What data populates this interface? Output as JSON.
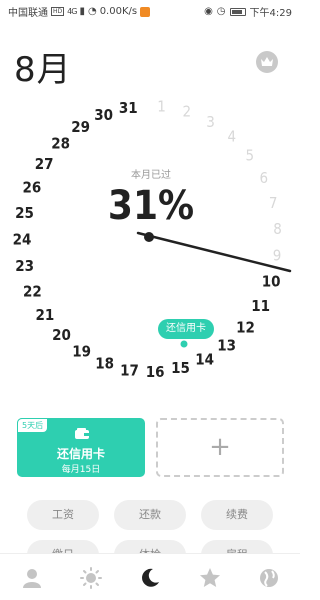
{
  "status_bar": {
    "carrier": "中国联通",
    "hd": "HD",
    "signal": "4G",
    "speed": "0.00K/s",
    "time": "下午4:29"
  },
  "header": {
    "month": "8月",
    "vip_icon": "crown-icon"
  },
  "dial": {
    "caption": "本月已过",
    "percent": "31%",
    "numbers": [
      "1",
      "2",
      "3",
      "4",
      "5",
      "6",
      "7",
      "8",
      "9",
      "10",
      "11",
      "12",
      "13",
      "14",
      "15",
      "16",
      "17",
      "18",
      "19",
      "20",
      "21",
      "22",
      "23",
      "24",
      "25",
      "26",
      "27",
      "28",
      "29",
      "30",
      "31"
    ],
    "elapsed_days": 9,
    "current_day": "10",
    "tag_label": "还信用卡",
    "colors": {
      "active": "#222222",
      "inactive": "#d8d8d8",
      "accent": "#2ecfb0"
    }
  },
  "cards": {
    "reminder": {
      "badge": "5天后",
      "title": "还信用卡",
      "subtitle": "每月15日",
      "icon": "wallet-icon"
    },
    "add_label": "+"
  },
  "chips": [
    "工资",
    "还款",
    "续费",
    "缴日",
    "体检",
    "房租"
  ],
  "nav": [
    "person-icon",
    "sun-icon",
    "moon-icon",
    "star-icon",
    "globe-icon"
  ]
}
